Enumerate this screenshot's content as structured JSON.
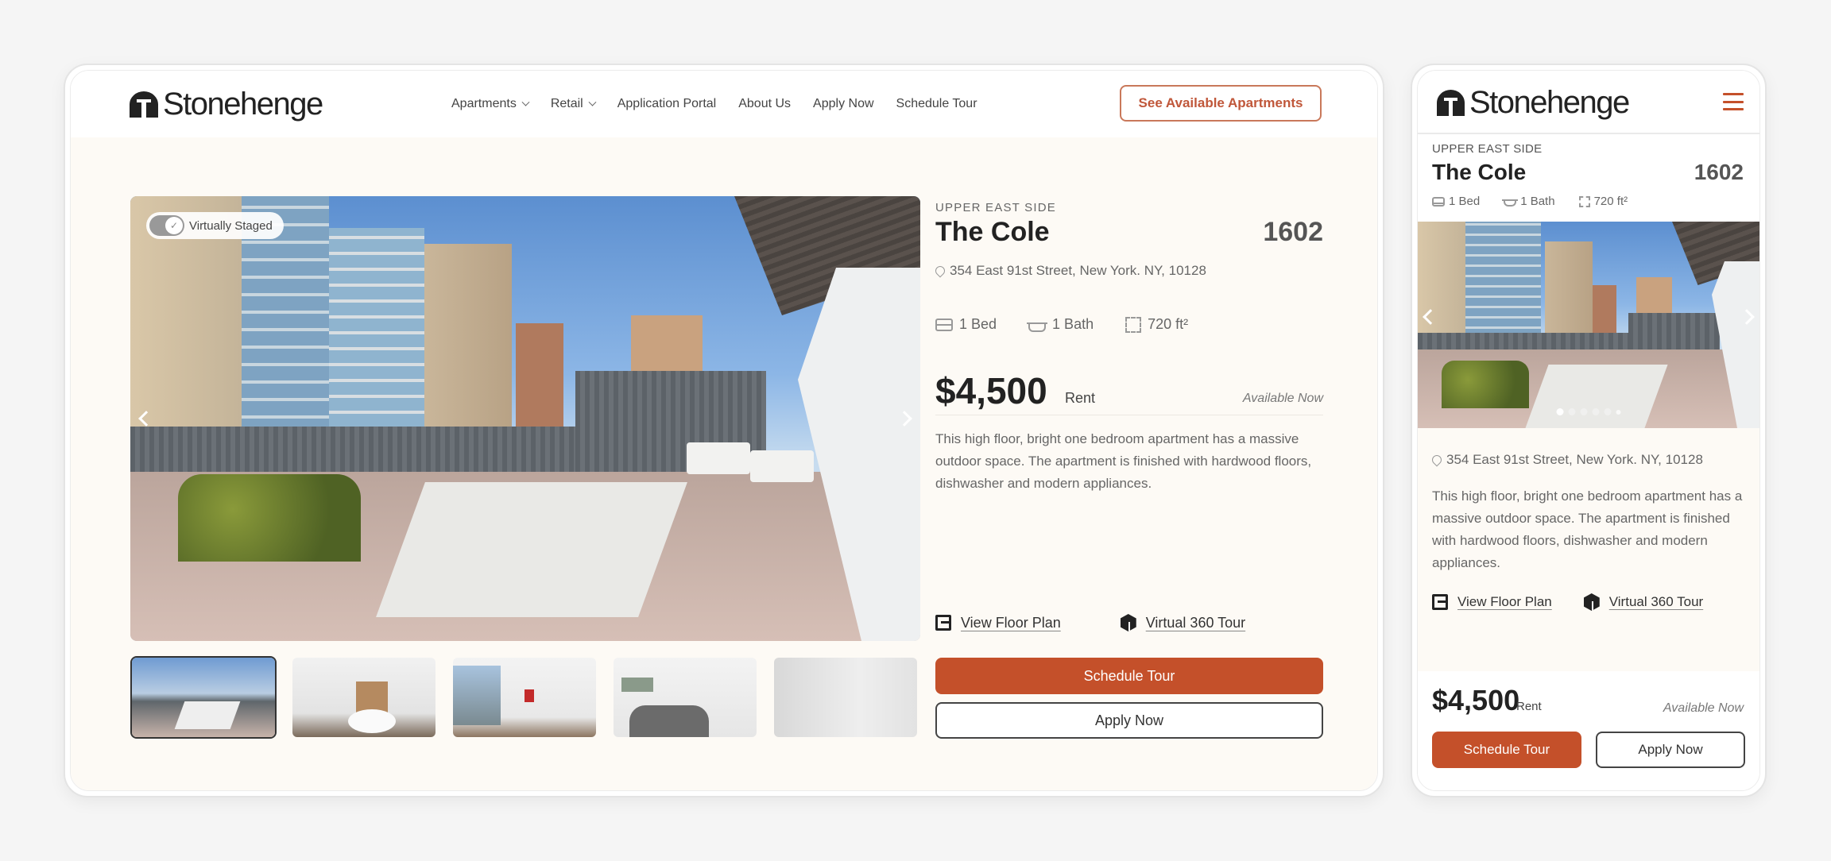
{
  "brand": {
    "name": "Stonehenge",
    "accent_color": "#c4502a"
  },
  "desktop": {
    "nav": [
      {
        "label": "Apartments",
        "has_dropdown": true
      },
      {
        "label": "Retail",
        "has_dropdown": true
      },
      {
        "label": "Application Portal",
        "has_dropdown": false
      },
      {
        "label": "About Us",
        "has_dropdown": false
      },
      {
        "label": "Apply Now",
        "has_dropdown": false
      },
      {
        "label": "Schedule Tour",
        "has_dropdown": false
      }
    ],
    "cta_label": "See Available Apartments",
    "gallery": {
      "badge_label": "Virtually Staged",
      "badge_toggle_on": true,
      "thumbnails": [
        {
          "alt": "Terrace",
          "active": true
        },
        {
          "alt": "Living room",
          "active": false
        },
        {
          "alt": "Living area with balcony door",
          "active": false
        },
        {
          "alt": "Bedroom",
          "active": false
        },
        {
          "alt": "Bathroom",
          "active": false
        }
      ]
    }
  },
  "listing": {
    "neighborhood": "UPPER EAST SIDE",
    "building": "The Cole",
    "unit": "1602",
    "address": "354 East 91st Street, New York. NY, 10128",
    "beds": "1 Bed",
    "baths": "1 Bath",
    "area": "720 ft²",
    "price": "$4,500",
    "price_label": "Rent",
    "availability": "Available Now",
    "description": "This high floor, bright one bedroom apartment has a massive outdoor space. The apartment is finished with hardwood floors, dishwasher and modern appliances.",
    "floor_plan_label": "View Floor Plan",
    "virtual_tour_label": "Virtual  360 Tour",
    "schedule_tour_label": "Schedule Tour",
    "apply_label": "Apply Now"
  },
  "mobile": {
    "carousel": {
      "total_slides": 6,
      "active_index": 0
    }
  }
}
